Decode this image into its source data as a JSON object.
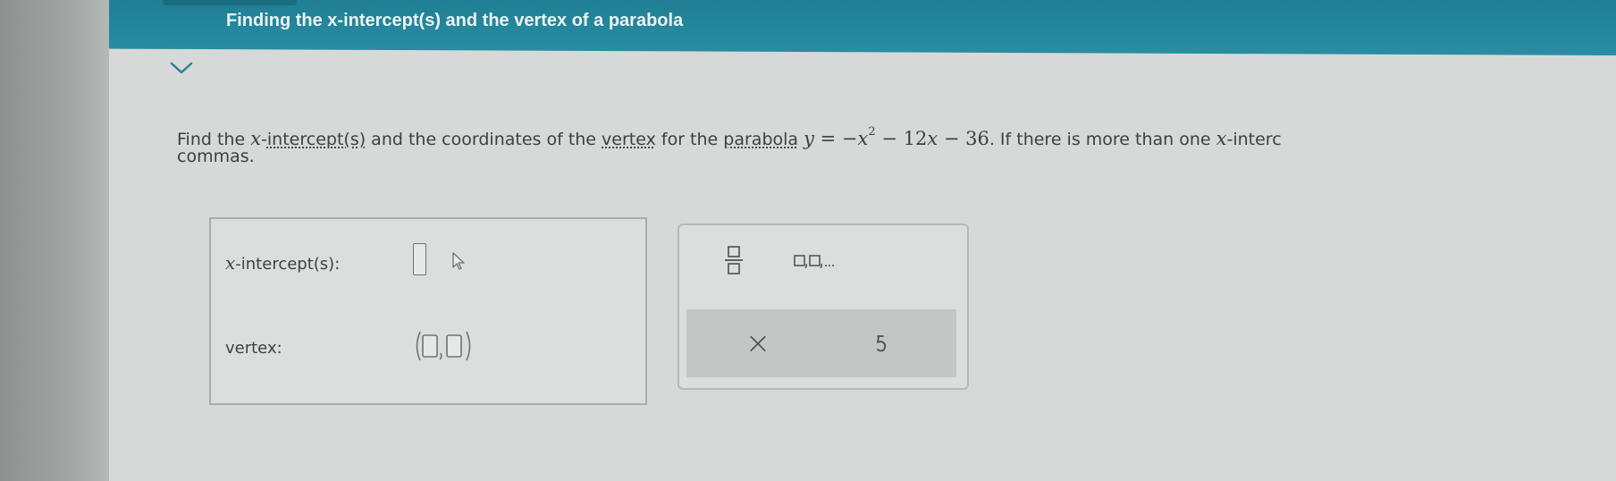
{
  "header": {
    "title": "Finding the x-intercept(s) and the vertex of a parabola"
  },
  "problem": {
    "intro": "Find the ",
    "xvar": "x",
    "dash": "-",
    "intercept_link": "intercept(s)",
    "mid": " and the coordinates of the ",
    "vertex_link": "vertex",
    "mid2": " for the ",
    "parabola_link": "parabola",
    "equation": {
      "lhs": "y",
      "eq": " = −",
      "term1": "x",
      "exp": "2",
      "rest": " − 12",
      "term2": "x",
      "rest2": " − 36"
    },
    "tail": ". If there is more than one ",
    "tail_x": "x",
    "tail_end": "-interc",
    "line2": "commas."
  },
  "answer": {
    "xint_var": "x",
    "xint_label": "-intercept(s):",
    "vertex_label": "vertex:"
  },
  "keypad": {
    "fraction": "fraction-icon",
    "list": "list-icon",
    "clear": "×",
    "undo": "undo-icon"
  }
}
